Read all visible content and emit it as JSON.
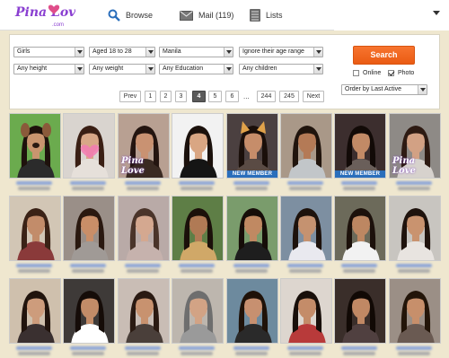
{
  "header": {
    "logo_text": "Pina Love",
    "logo_domain": ".com",
    "nav": [
      {
        "label": "Browse",
        "icon": "search-icon"
      },
      {
        "label": "Mail (119)",
        "icon": "envelope-icon"
      },
      {
        "label": "Lists",
        "icon": "list-icon"
      }
    ]
  },
  "filters": {
    "row1": [
      "Girls",
      "Aged 18 to 28",
      "Manila",
      "Ignore their age range"
    ],
    "row2": [
      "Any height",
      "Any weight",
      "Any Education",
      "Any children"
    ],
    "search_label": "Search",
    "online_label": "Online",
    "photo_label": "Photo",
    "online_checked": false,
    "photo_checked": true,
    "order_label": "Order by Last Active"
  },
  "pagination": {
    "prev": "Prev",
    "pages": [
      "1",
      "2",
      "3",
      "4",
      "5",
      "6"
    ],
    "active": "4",
    "dots": "...",
    "tail": [
      "244",
      "245"
    ],
    "next": "Next"
  },
  "profiles": [
    {
      "bg": "#6bab4e",
      "skin": "#c9956f",
      "hair": "#1e120c",
      "top": "#2b2b2b",
      "overlay": "dog"
    },
    {
      "bg": "#d9d4cf",
      "skin": "#d8a787",
      "hair": "#3a1f14",
      "top": "#e6e0da",
      "overlay": "heart"
    },
    {
      "bg": "#b8a092",
      "skin": "#c99272",
      "hair": "#241510",
      "top": "#3a2a22",
      "overlay": "pw"
    },
    {
      "bg": "#f2f2f2",
      "skin": "#d9a683",
      "hair": "#1b110c",
      "top": "#151515",
      "overlay": ""
    },
    {
      "bg": "#4b4040",
      "skin": "#c68d6a",
      "hair": "#1a0f0a",
      "top": "#5a4b44",
      "overlay": "cat",
      "badge": "NEW MEMBER"
    },
    {
      "bg": "#a99888",
      "skin": "#b47a56",
      "hair": "#20140d",
      "top": "#c2c6c9",
      "overlay": ""
    },
    {
      "bg": "#3c2e2e",
      "skin": "#c28a66",
      "hair": "#120a07",
      "top": "#6a5f5a",
      "overlay": "",
      "badge": "NEW MEMBER"
    },
    {
      "bg": "#8e8a86",
      "skin": "#d2a184",
      "hair": "#2d1a12",
      "top": "#d7d2cd",
      "overlay": "pw"
    },
    {
      "bg": "#d2c6b5",
      "skin": "#c28c6a",
      "hair": "#3a2216",
      "top": "#8a3a3a",
      "overlay": ""
    },
    {
      "bg": "#9a8f88",
      "skin": "#c98e68",
      "hair": "#2a180f",
      "top": "#a09a96",
      "overlay": ""
    },
    {
      "bg": "#b9aaa7",
      "skin": "#d4a890",
      "hair": "#4a342a",
      "top": "#c6b2ad",
      "overlay": ""
    },
    {
      "bg": "#5e7e46",
      "skin": "#b07a55",
      "hair": "#1b100a",
      "top": "#d0a868",
      "overlay": ""
    },
    {
      "bg": "#7a9c6c",
      "skin": "#c08962",
      "hair": "#160d08",
      "top": "#1e1e1e",
      "overlay": ""
    },
    {
      "bg": "#7d8fa1",
      "skin": "#c59270",
      "hair": "#1d120c",
      "top": "#e9e9ef",
      "overlay": ""
    },
    {
      "bg": "#6c6a5a",
      "skin": "#bd8762",
      "hair": "#1c110b",
      "top": "#f2f2f2",
      "overlay": ""
    },
    {
      "bg": "#c8c5c0",
      "skin": "#c9936f",
      "hair": "#1f130d",
      "top": "#e8e4e0",
      "overlay": ""
    },
    {
      "bg": "#cfc0ad",
      "skin": "#cd9c7c",
      "hair": "#21140d",
      "top": "#3a3030",
      "overlay": ""
    },
    {
      "bg": "#3e3a38",
      "skin": "#c28c68",
      "hair": "#150c08",
      "top": "#ffffff",
      "overlay": ""
    },
    {
      "bg": "#c9bdb5",
      "skin": "#c8926f",
      "hair": "#2a1a12",
      "top": "#4a3f3a",
      "overlay": ""
    },
    {
      "bg": "#bdb6ae",
      "skin": "#d2a385",
      "hair": "#6e6e6e",
      "top": "#9a9a9a",
      "overlay": ""
    },
    {
      "bg": "#6d8a9e",
      "skin": "#c79070",
      "hair": "#1f1209",
      "top": "#2a2a2a",
      "overlay": ""
    },
    {
      "bg": "#ddd6cf",
      "skin": "#c48c69",
      "hair": "#180f0a",
      "top": "#b83a3a",
      "overlay": ""
    },
    {
      "bg": "#3a2e2a",
      "skin": "#c08864",
      "hair": "#110905",
      "top": "#504040",
      "overlay": ""
    },
    {
      "bg": "#9b8f86",
      "skin": "#c78f6b",
      "hair": "#231509",
      "top": "#6a5a52",
      "overlay": ""
    }
  ],
  "colors": {
    "page_bg": "#efe7cf",
    "accent": "#ea5b13",
    "badge": "#2a6ebb",
    "logo": "#8a3fd1"
  }
}
